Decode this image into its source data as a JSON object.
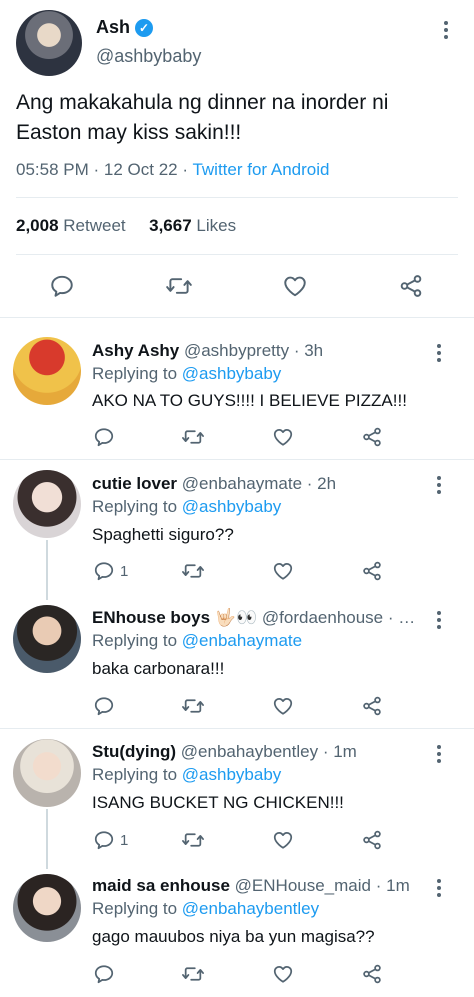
{
  "main_tweet": {
    "author_name": "Ash",
    "verified_badge": "✓",
    "author_handle": "@ashbybaby",
    "text": "Ang makakahula ng dinner na inorder ni Easton may kiss sakin!!!",
    "time": "05:58 PM",
    "date": "12 Oct 22",
    "sep1": "·",
    "sep2": "·",
    "source": "Twitter for Android",
    "retweet_count": "2,008",
    "retweet_label": "Retweet",
    "like_count": "3,667",
    "like_label": "Likes",
    "icons": [
      "reply-icon",
      "retweet-icon",
      "like-icon",
      "share-icon"
    ]
  },
  "replies": [
    {
      "name": "Ashy Ashy",
      "handle": "@ashbypretty",
      "time": "· 3h",
      "replying_label": "Replying to",
      "replying_to": "@ashbybaby",
      "text": "AKO NA TO GUYS!!!! I BELIEVE PIZZA!!!",
      "reply_count": ""
    },
    {
      "name": "cutie lover",
      "handle": "@enbahaymate",
      "time": "· 2h",
      "replying_label": "Replying to",
      "replying_to": "@ashbybaby",
      "text": "Spaghetti siguro??",
      "reply_count": "1"
    },
    {
      "name": "ENhouse boys",
      "name_emoji": "🤟🏻👀",
      "handle": "@fordaenhouse",
      "time": "· …",
      "replying_label": "Replying to",
      "replying_to": "@enbahaymate",
      "text": "baka carbonara!!!",
      "reply_count": ""
    },
    {
      "name": "Stu(dying)",
      "handle": "@enbahaybentley",
      "time": "· 1m",
      "replying_label": "Replying to",
      "replying_to": "@ashbybaby",
      "text": "ISANG BUCKET NG CHICKEN!!!",
      "reply_count": "1"
    },
    {
      "name": "maid sa enhouse",
      "handle": "@ENHouse_maid",
      "time": "· 1m",
      "replying_label": "Replying to",
      "replying_to": "@enbahaybentley",
      "text": "gago mauubos niya ba yun magisa??",
      "reply_count": ""
    }
  ],
  "colors": {
    "accent": "#1d9bf0",
    "secondary_text": "#536471",
    "primary_text": "#0f1419",
    "divider": "#e6ecf0"
  }
}
